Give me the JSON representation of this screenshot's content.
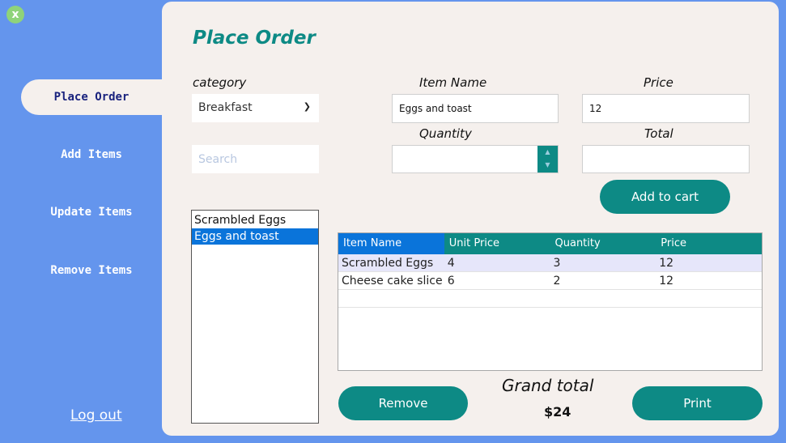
{
  "window": {
    "close_label": "x"
  },
  "sidebar": {
    "items": [
      {
        "label": "Place Order"
      },
      {
        "label": "Add Items"
      },
      {
        "label": "Update Items"
      },
      {
        "label": "Remove Items"
      }
    ],
    "logout_label": "Log out"
  },
  "main": {
    "title": "Place Order",
    "labels": {
      "category": "category",
      "item_name": "Item Name",
      "price": "Price",
      "quantity": "Quantity",
      "total": "Total"
    },
    "category_value": "Breakfast",
    "search_placeholder": "Search",
    "item_name_value": "Eggs and toast",
    "price_value": "12",
    "quantity_value": "",
    "total_value": "",
    "add_to_cart_label": "Add to cart",
    "list_items": [
      "Scrambled Eggs",
      "Eggs and toast"
    ],
    "selected_list_item": "Eggs and toast",
    "table": {
      "headers": [
        "Item Name",
        "Unit Price",
        "Quantity",
        "Price"
      ],
      "rows": [
        [
          "Scrambled Eggs",
          "4",
          "3",
          "12"
        ],
        [
          "Cheese cake slice",
          "6",
          "2",
          "12"
        ]
      ]
    },
    "remove_label": "Remove",
    "print_label": "Print",
    "grand_total_label": "Grand total",
    "grand_total_value": "$24"
  },
  "colors": {
    "sidebar_bg": "#6495ed",
    "panel_bg": "#f5f0ed",
    "accent_teal": "#0d8a85",
    "selection_blue": "#0a74da"
  }
}
